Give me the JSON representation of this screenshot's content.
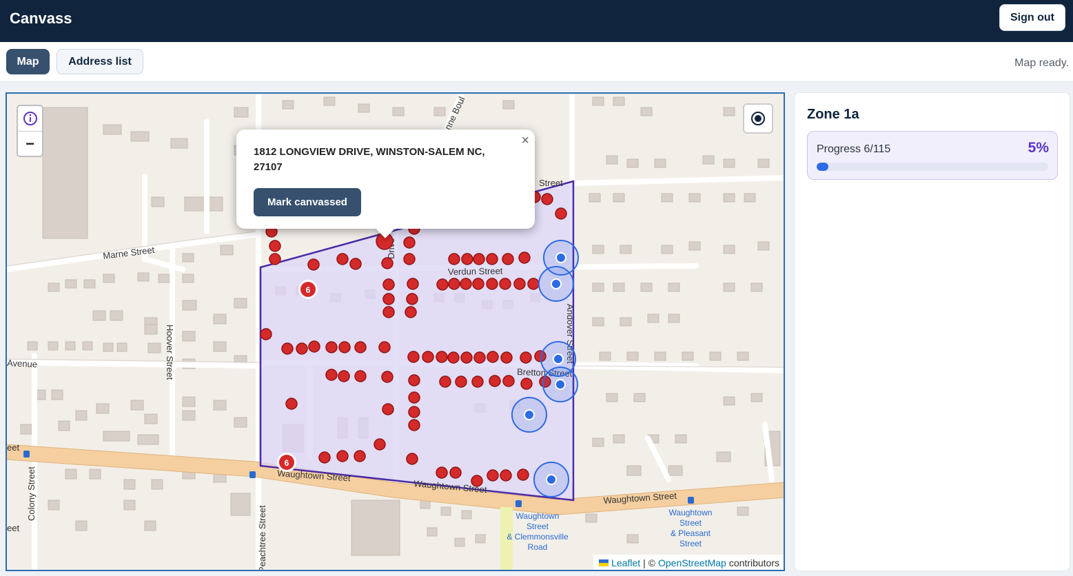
{
  "app": {
    "title": "Canvass",
    "sign_out_label": "Sign out"
  },
  "tabs": [
    {
      "label": "Map",
      "active": true
    },
    {
      "label": "Address list",
      "active": false
    }
  ],
  "status": {
    "text": "Map ready."
  },
  "map": {
    "controls": {
      "info_icon": "info-icon",
      "zoom_out_label": "−",
      "locate_icon": "locate-icon"
    },
    "popup": {
      "address": "1812 LONGVIEW DRIVE, WINSTON-SALEM NC, 27107",
      "action_label": "Mark canvassed",
      "close_label": "×"
    },
    "street_labels": [
      "Marne Street",
      "Verdun Street",
      "Bretton Street",
      "Waughtown Street",
      "Waughtown Street",
      "Waughtown Street",
      "Hoover Street",
      "Avenue",
      "Colony Street",
      "Peachtree Street",
      "Andover Street",
      "Street",
      "eet",
      "eet",
      "Drive",
      "onne Boul"
    ],
    "poi_labels": [
      "Waughtown Street & Clemmonsville Road",
      "Waughtown Street & Pleasant Street"
    ],
    "cluster_counts": [
      "6",
      "6"
    ],
    "marker_colors": {
      "pending": "#d42a2a",
      "canvassed": "#2d6be4",
      "zone_fill": "#d9d3f6",
      "zone_border": "#4b2aa6"
    },
    "attribution": {
      "leaflet": "Leaflet",
      "separator": "| ©",
      "osm": "OpenStreetMap",
      "suffix": "contributors"
    }
  },
  "zone": {
    "name": "Zone 1a",
    "progress_label": "Progress 6/115",
    "progress_percent": "5%",
    "progress_fraction": 0.052
  }
}
